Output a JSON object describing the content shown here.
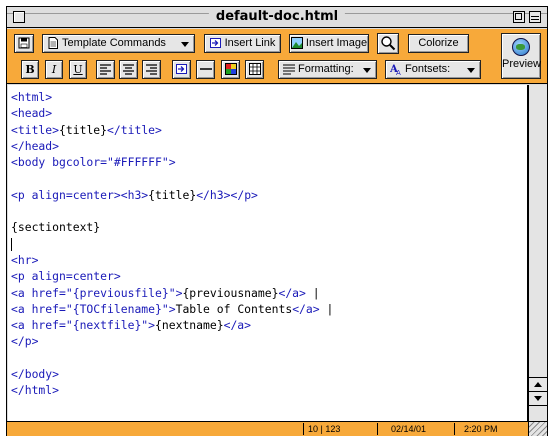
{
  "window": {
    "title": "default-doc.html"
  },
  "toolbar": {
    "template_commands": "Template Commands",
    "insert_link": "Insert Link",
    "insert_image": "Insert Image",
    "colorize": "Colorize",
    "bold": "B",
    "italic": "I",
    "underline": "U",
    "formatting": "Formatting:",
    "fontsets": "Fontsets:",
    "preview": "Preview"
  },
  "editor": {
    "lines": [
      [
        {
          "t": "<html>",
          "k": "tag"
        }
      ],
      [
        {
          "t": "<head>",
          "k": "tag"
        }
      ],
      [
        {
          "t": "<title>",
          "k": "tag"
        },
        {
          "t": "{title}",
          "k": "txt"
        },
        {
          "t": "</title>",
          "k": "tag"
        }
      ],
      [
        {
          "t": "</head>",
          "k": "tag"
        }
      ],
      [
        {
          "t": "<body bgcolor=\"#FFFFFF\">",
          "k": "tag"
        }
      ],
      [],
      [
        {
          "t": "<p align=center>",
          "k": "tag"
        },
        {
          "t": "<h3>",
          "k": "tag"
        },
        {
          "t": "{title}",
          "k": "txt"
        },
        {
          "t": "</h3>",
          "k": "tag"
        },
        {
          "t": "</p>",
          "k": "tag"
        }
      ],
      [],
      [
        {
          "t": "{sectiontext}",
          "k": "txt"
        }
      ],
      [
        {
          "t": "",
          "k": "cursor"
        }
      ],
      [
        {
          "t": "<hr>",
          "k": "tag"
        }
      ],
      [
        {
          "t": "<p align=center>",
          "k": "tag"
        }
      ],
      [
        {
          "t": "<a href=\"{previousfile}\">",
          "k": "tag"
        },
        {
          "t": "{previousname}",
          "k": "txt"
        },
        {
          "t": "</a>",
          "k": "tag"
        },
        {
          "t": " |",
          "k": "txt"
        }
      ],
      [
        {
          "t": "<a href=\"{TOCfilename}\">",
          "k": "tag"
        },
        {
          "t": "Table of Contents",
          "k": "txt"
        },
        {
          "t": "</a>",
          "k": "tag"
        },
        {
          "t": " |",
          "k": "txt"
        }
      ],
      [
        {
          "t": "<a href=\"{nextfile}\">",
          "k": "tag"
        },
        {
          "t": "{nextname}",
          "k": "txt"
        },
        {
          "t": "</a>",
          "k": "tag"
        }
      ],
      [
        {
          "t": "</p>",
          "k": "tag"
        }
      ],
      [],
      [
        {
          "t": "</body>",
          "k": "tag"
        }
      ],
      [
        {
          "t": "</html>",
          "k": "tag"
        }
      ]
    ]
  },
  "status": {
    "position": "10 | 123",
    "date": "02/14/01",
    "time": "2:20 PM"
  },
  "colors": {
    "toolbar_bg": "#f7a93a",
    "tag_color": "#1a1ab8",
    "text_color": "#000000"
  }
}
